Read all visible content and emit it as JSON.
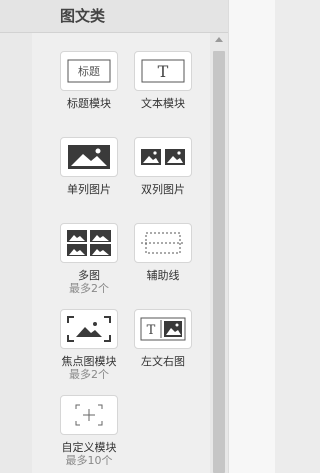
{
  "panel": {
    "title": "图文类"
  },
  "modules": [
    {
      "key": "title",
      "label": "标题模块",
      "icon": "title-text-icon",
      "icon_text": "标题"
    },
    {
      "key": "text",
      "label": "文本模块",
      "icon": "text-t-icon",
      "icon_text": "T"
    },
    {
      "key": "single-pic",
      "label": "单列图片",
      "icon": "single-image-icon"
    },
    {
      "key": "double-pic",
      "label": "双列图片",
      "icon": "double-image-icon"
    },
    {
      "key": "multi-pic",
      "label": "多图",
      "sub": "最多2个",
      "icon": "multi-image-icon"
    },
    {
      "key": "guide-line",
      "label": "辅助线",
      "icon": "dashed-guide-icon"
    },
    {
      "key": "focus-pic",
      "label": "焦点图模块",
      "sub": "最多2个",
      "icon": "focus-image-icon"
    },
    {
      "key": "text-left-pic-right",
      "label": "左文右图",
      "icon": "text-left-image-right-icon",
      "icon_text": "T"
    },
    {
      "key": "custom",
      "label": "自定义模块",
      "sub": "最多10个",
      "icon": "custom-plus-icon"
    }
  ],
  "colors": {
    "panel_bg": "#efefef",
    "icon_dark": "#3a3a3a",
    "border": "#d6d6d6"
  }
}
